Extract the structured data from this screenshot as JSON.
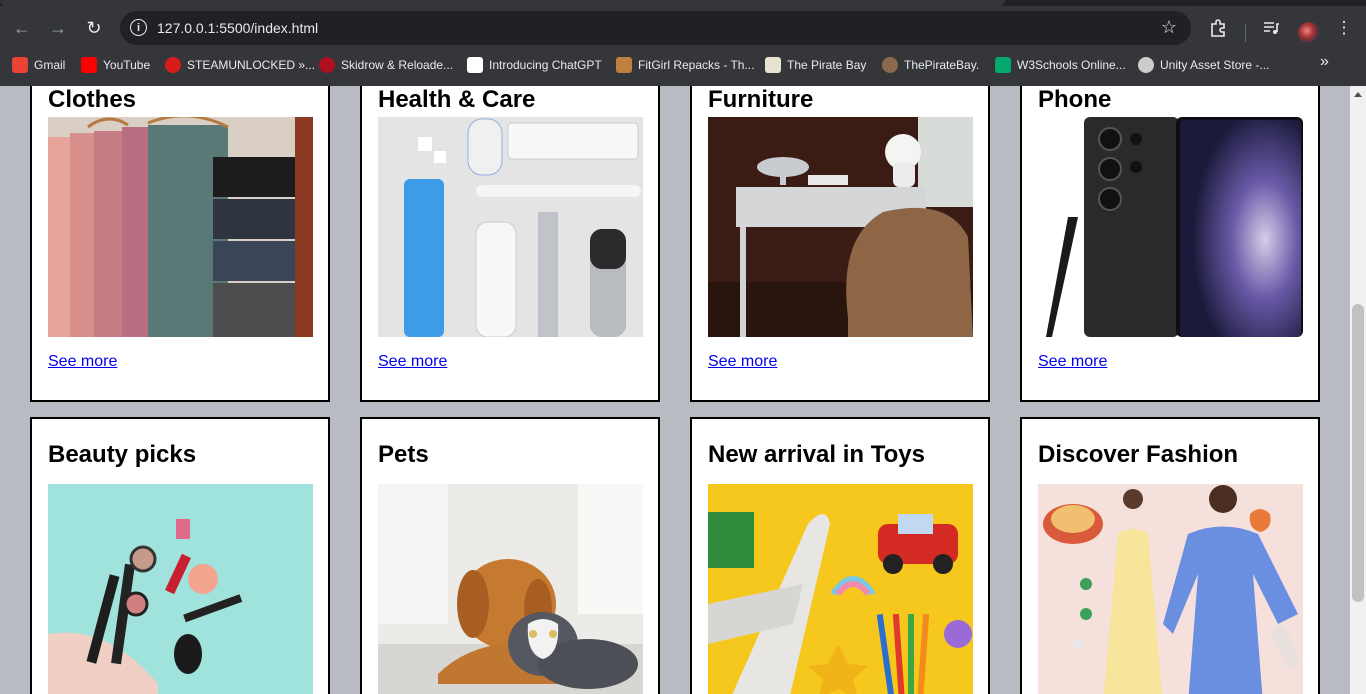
{
  "browser": {
    "url": "127.0.0.1:5500/index.html",
    "bookmarks": [
      {
        "label": "Gmail",
        "icon": "gmail-icon",
        "color": "#ea4335"
      },
      {
        "label": "YouTube",
        "icon": "youtube-icon",
        "color": "#ff0000"
      },
      {
        "label": "STEAMUNLOCKED »...",
        "icon": "steamunlocked-icon",
        "color": "#d81b1b"
      },
      {
        "label": "Skidrow & Reloade...",
        "icon": "skidrow-icon",
        "color": "#b01020"
      },
      {
        "label": "Introducing ChatGPT",
        "icon": "openai-icon",
        "color": "#ffffff"
      },
      {
        "label": "FitGirl Repacks - Th...",
        "icon": "fitgirl-icon",
        "color": "#c08040"
      },
      {
        "label": "The Pirate Bay",
        "icon": "piratebay-icon",
        "color": "#e8e2d0"
      },
      {
        "label": "ThePirateBay.",
        "icon": "piratebay-ship-icon",
        "color": "#8a6a4a"
      },
      {
        "label": "W3Schools Online...",
        "icon": "w3schools-icon",
        "color": "#04aa6d"
      },
      {
        "label": "Unity Asset Store -...",
        "icon": "unity-icon",
        "color": "#cccccc"
      }
    ]
  },
  "page": {
    "link_label": "See more",
    "cards": [
      {
        "title": "Clothes",
        "image": "clothes-hanging-image",
        "has_link": true
      },
      {
        "title": "Health & Care",
        "image": "toiletries-image",
        "has_link": true
      },
      {
        "title": "Furniture",
        "image": "desk-chair-image",
        "has_link": true
      },
      {
        "title": "Phone",
        "image": "smartphone-image",
        "has_link": true
      },
      {
        "title": "Beauty picks",
        "image": "makeup-image",
        "has_link": false
      },
      {
        "title": "Pets",
        "image": "dog-cat-image",
        "has_link": false
      },
      {
        "title": "New arrival in Toys",
        "image": "toys-image",
        "has_link": false
      },
      {
        "title": "Discover Fashion",
        "image": "fashion-models-image",
        "has_link": false
      }
    ]
  }
}
